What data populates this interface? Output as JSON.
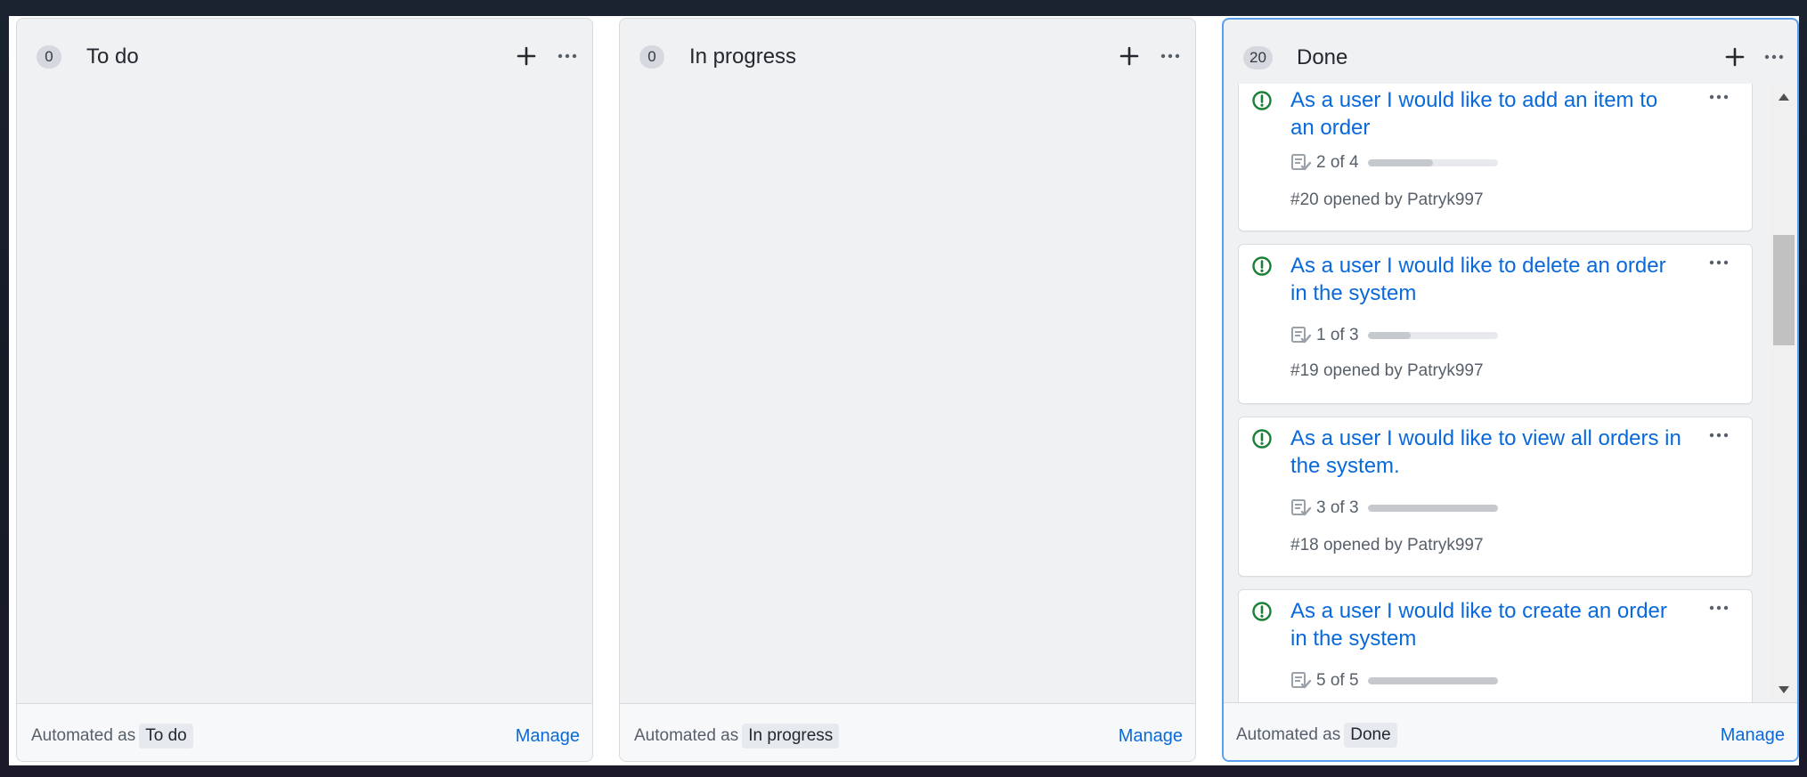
{
  "columns": [
    {
      "count": "0",
      "title": "To do",
      "footer_prefix": "Automated as",
      "footer_tag": "To do",
      "manage_label": "Manage",
      "add_icon": "plus-icon",
      "menu_icon": "kebab-horizontal-icon"
    },
    {
      "count": "0",
      "title": "In progress",
      "footer_prefix": "Automated as",
      "footer_tag": "In progress",
      "manage_label": "Manage",
      "add_icon": "plus-icon",
      "menu_icon": "kebab-horizontal-icon"
    },
    {
      "count": "20",
      "title": "Done",
      "footer_prefix": "Automated as",
      "footer_tag": "Done",
      "manage_label": "Manage",
      "add_icon": "plus-icon",
      "menu_icon": "kebab-horizontal-icon",
      "cards": [
        {
          "title": "As a user I would like to add an item to an order",
          "tasks": "2 of 4",
          "progress": 0.5,
          "meta": "#20 opened by Patryk997",
          "status_icon": "issue-opened-icon"
        },
        {
          "title": "As a user I would like to delete an order in the system",
          "tasks": "1 of 3",
          "progress": 0.333,
          "meta": "#19 opened by Patryk997",
          "status_icon": "issue-opened-icon"
        },
        {
          "title": "As a user I would like to view all orders in the system.",
          "tasks": "3 of 3",
          "progress": 1.0,
          "meta": "#18 opened by Patryk997",
          "status_icon": "issue-opened-icon"
        },
        {
          "title": "As a user I would like to create an order in the system",
          "tasks": "5 of 5",
          "progress": 1.0,
          "meta": "",
          "status_icon": "issue-opened-icon"
        }
      ]
    }
  ],
  "colors": {
    "link": "#0969da",
    "issue_open": "#1a7f37",
    "selected_border": "#5a9ef0",
    "column_bg": "#eff1f3"
  }
}
